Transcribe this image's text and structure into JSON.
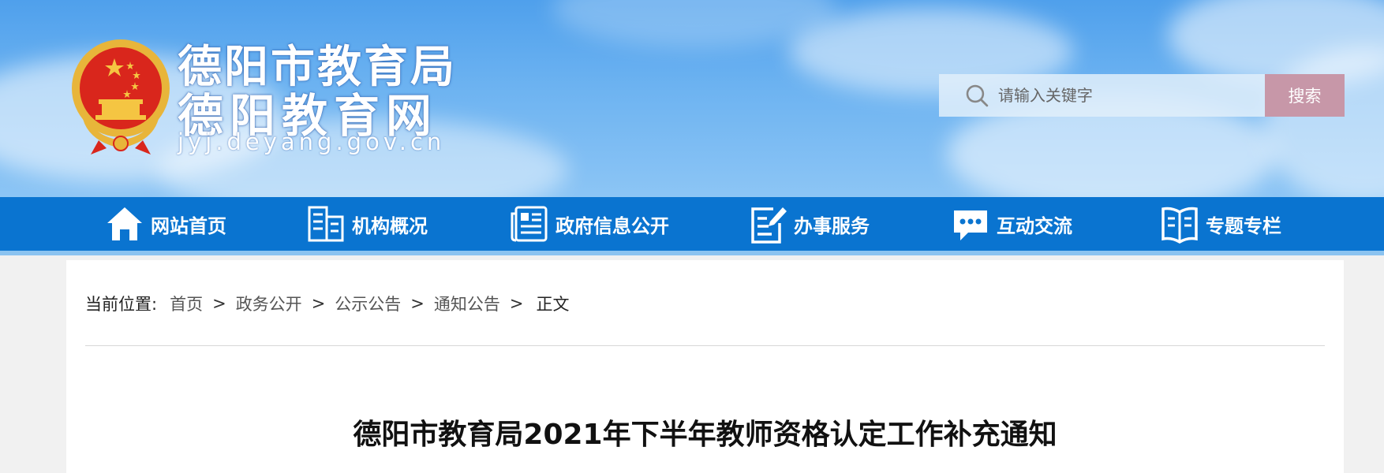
{
  "header": {
    "title_main": "德阳市教育局",
    "title_sub": "德阳教育网",
    "domain": "jyj.deyang.gov.cn",
    "emblem_icon": "national-emblem-icon"
  },
  "search": {
    "placeholder": "请输入关键字",
    "button_label": "搜索",
    "button_color": "#c797a8"
  },
  "nav": {
    "items": [
      {
        "label": "网站首页",
        "icon": "home-icon"
      },
      {
        "label": "机构概况",
        "icon": "building-icon"
      },
      {
        "label": "政府信息公开",
        "icon": "newspaper-icon"
      },
      {
        "label": "办事服务",
        "icon": "document-edit-icon"
      },
      {
        "label": "互动交流",
        "icon": "chat-icon"
      },
      {
        "label": "专题专栏",
        "icon": "book-icon"
      }
    ],
    "background": "#0a74d0"
  },
  "breadcrumb": {
    "label": "当前位置:",
    "items": [
      "首页",
      "政务公开",
      "公示公告",
      "通知公告"
    ],
    "separator": ">",
    "current": "正文"
  },
  "article": {
    "title": "德阳市教育局2021年下半年教师资格认定工作补充通知"
  }
}
